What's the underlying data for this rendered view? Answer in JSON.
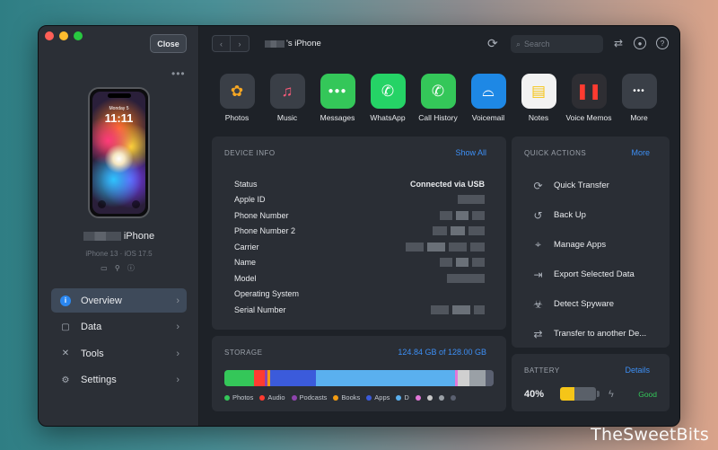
{
  "sidebar": {
    "close_label": "Close",
    "more_dots": "•••",
    "phone": {
      "date": "Monday 5",
      "time": "11:11"
    },
    "device_name": "iPhone",
    "device_sub": "iPhone 13 · iOS 17.5",
    "device_icons": "▭ ⚲ ⓘ",
    "nav": [
      {
        "label": "Overview",
        "icon": "info-icon",
        "glyph": "i"
      },
      {
        "label": "Data",
        "icon": "square-icon",
        "glyph": "▢"
      },
      {
        "label": "Tools",
        "icon": "tools-icon",
        "glyph": "✕"
      },
      {
        "label": "Settings",
        "icon": "gear-icon",
        "glyph": "⚙"
      }
    ]
  },
  "topbar": {
    "title": "'s iPhone",
    "search_placeholder": "Search",
    "back": "‹",
    "forward": "›"
  },
  "apps": [
    {
      "label": "Photos",
      "icon": "photos-icon",
      "glyph": "✿",
      "color": "#f5a623",
      "bg": "#3a3f47"
    },
    {
      "label": "Music",
      "icon": "music-icon",
      "glyph": "♫",
      "color": "#ff5b7b",
      "bg": "#3a3f47"
    },
    {
      "label": "Messages",
      "icon": "messages-icon",
      "glyph": "●●●",
      "color": "#ffffff",
      "bg": "#34c759"
    },
    {
      "label": "WhatsApp",
      "icon": "whatsapp-icon",
      "glyph": "✆",
      "color": "#ffffff",
      "bg": "#25d366"
    },
    {
      "label": "Call History",
      "icon": "phone-icon",
      "glyph": "✆",
      "color": "#ffffff",
      "bg": "#34c759"
    },
    {
      "label": "Voicemail",
      "icon": "voicemail-icon",
      "glyph": "⌓",
      "color": "#ffffff",
      "bg": "#1e88e5"
    },
    {
      "label": "Notes",
      "icon": "notes-icon",
      "glyph": "▤",
      "color": "#f5c518",
      "bg": "#f2f2f2"
    },
    {
      "label": "Voice Memos",
      "icon": "voice-memos-icon",
      "glyph": "❚❚",
      "color": "#ff3b30",
      "bg": "#2e2e33"
    },
    {
      "label": "More",
      "icon": "more-icon",
      "glyph": "•••",
      "color": "#ffffff",
      "bg": "#3a3f47"
    }
  ],
  "device_info": {
    "title": "DEVICE INFO",
    "link": "Show All",
    "rows": [
      {
        "label": "Status",
        "value": "Connected via USB"
      },
      {
        "label": "Apple ID",
        "value": ""
      },
      {
        "label": "Phone Number",
        "value": ""
      },
      {
        "label": "Phone Number 2",
        "value": ""
      },
      {
        "label": "Carrier",
        "value": ""
      },
      {
        "label": "Name",
        "value": ""
      },
      {
        "label": "Model",
        "value": ""
      },
      {
        "label": "Operating System",
        "value": ""
      },
      {
        "label": "Serial Number",
        "value": ""
      }
    ]
  },
  "quick_actions": {
    "title": "QUICK ACTIONS",
    "link": "More",
    "items": [
      {
        "label": "Quick Transfer",
        "icon": "quick-transfer-icon",
        "glyph": "⟳"
      },
      {
        "label": "Back Up",
        "icon": "backup-icon",
        "glyph": "↺"
      },
      {
        "label": "Manage Apps",
        "icon": "apps-icon",
        "glyph": "⌖"
      },
      {
        "label": "Export Selected Data",
        "icon": "export-icon",
        "glyph": "⇥"
      },
      {
        "label": "Detect Spyware",
        "icon": "spyware-icon",
        "glyph": "☣"
      },
      {
        "label": "Transfer to another De...",
        "icon": "transfer-device-icon",
        "glyph": "⇄"
      }
    ]
  },
  "storage": {
    "title": "STORAGE",
    "used_label": "124.84 GB of 128.00 GB",
    "segments": [
      {
        "name": "Photos",
        "color": "#34c759",
        "fraction": 0.11
      },
      {
        "name": "Audio",
        "color": "#ff3b30",
        "fraction": 0.04
      },
      {
        "name": "Podcasts",
        "color": "#8e44ad",
        "fraction": 0.01
      },
      {
        "name": "Books",
        "color": "#f39c12",
        "fraction": 0.01
      },
      {
        "name": "Apps",
        "color": "#3b5bdb",
        "fraction": 0.17
      },
      {
        "name": "D",
        "color": "#5ab0ef",
        "fraction": 0.515
      },
      {
        "name": "",
        "color": "#e277d8",
        "fraction": 0.01
      },
      {
        "name": "",
        "color": "#d0d0d0",
        "fraction": 0.045
      },
      {
        "name": "",
        "color": "#9aa0a6",
        "fraction": 0.06
      },
      {
        "name": "",
        "color": "#5a6070",
        "fraction": 0.04
      }
    ],
    "legend": [
      {
        "name": "Photos",
        "color": "#34c759"
      },
      {
        "name": "Audio",
        "color": "#ff3b30"
      },
      {
        "name": "Podcasts",
        "color": "#8e44ad"
      },
      {
        "name": "Books",
        "color": "#f39c12"
      },
      {
        "name": "Apps",
        "color": "#3b5bdb"
      },
      {
        "name": "D",
        "color": "#5ab0ef"
      },
      {
        "name": "",
        "color": "#e277d8"
      },
      {
        "name": "",
        "color": "#c8c8c8"
      },
      {
        "name": "",
        "color": "#9aa0a6"
      },
      {
        "name": "",
        "color": "#5a6070"
      }
    ]
  },
  "battery": {
    "title": "BATTERY",
    "link": "Details",
    "percent_label": "40%",
    "level": 0.4,
    "fill_color": "#f5c518",
    "bolt": "ϟ",
    "status": "Good"
  },
  "watermark": "TheSweetBits"
}
